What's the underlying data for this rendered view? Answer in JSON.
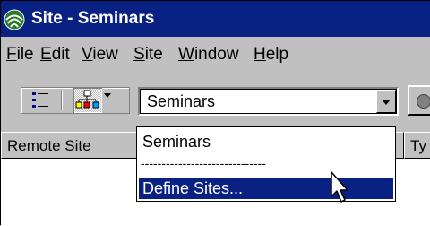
{
  "window": {
    "title": "Site - Seminars",
    "icon": "site-globe-icon"
  },
  "menu": [
    {
      "label": "File",
      "u": "F",
      "rest": "ile"
    },
    {
      "label": "Edit",
      "u": "E",
      "rest": "dit"
    },
    {
      "label": "View",
      "u": "V",
      "rest": "iew"
    },
    {
      "label": "Site",
      "u": "S",
      "rest": "ite"
    },
    {
      "label": "Window",
      "u": "W",
      "rest": "indow"
    },
    {
      "label": "Help",
      "u": "H",
      "rest": "elp"
    }
  ],
  "toolbar": {
    "list_view_icon": "list-view-icon",
    "site_map_icon": "site-map-icon",
    "site_combo": {
      "value": "Seminars"
    }
  },
  "columns": [
    {
      "label": "Remote Site"
    },
    {
      "label": "Ty"
    }
  ],
  "dropdown": {
    "items": [
      {
        "label": "Seminars"
      },
      {
        "label": "------------------------------"
      },
      {
        "label": "Define Sites..."
      }
    ],
    "selected_index": 2
  },
  "colors": {
    "titlebar": "#0a2184",
    "selection": "#0a2184",
    "chrome": "#c0c0c0"
  }
}
